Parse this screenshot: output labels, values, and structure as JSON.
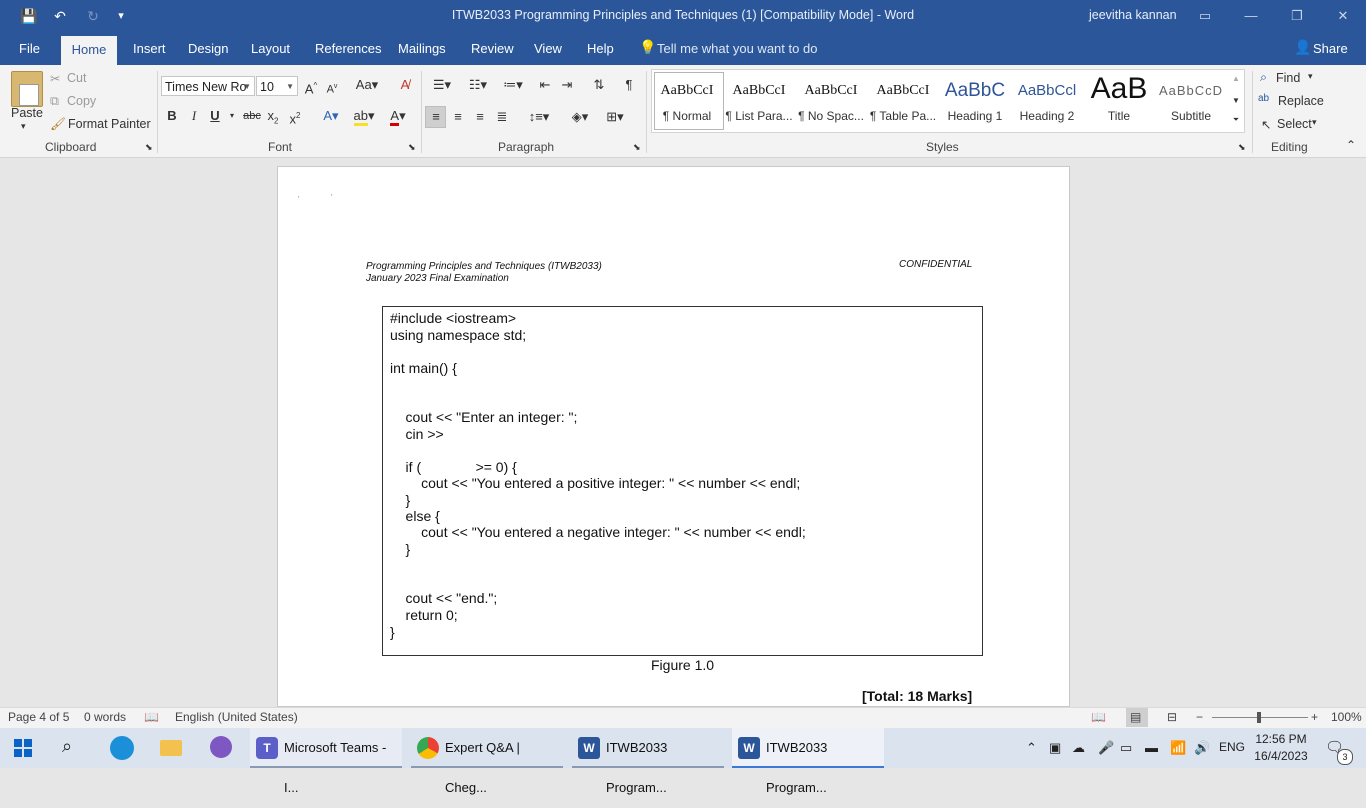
{
  "window": {
    "title": "ITWB2033 Programming Principles and Techniques (1) [Compatibility Mode]  -  Word",
    "user": "jeevitha kannan"
  },
  "quick_access": {
    "save": "💾",
    "undo": "↶",
    "redo": "↻",
    "customize": "▾"
  },
  "tabs": [
    "File",
    "Home",
    "Insert",
    "Design",
    "Layout",
    "References",
    "Mailings",
    "Review",
    "View",
    "Help"
  ],
  "tell_me": "Tell me what you want to do",
  "share": "Share",
  "ribbon": {
    "clipboard": {
      "paste": "Paste",
      "cut": "Cut",
      "copy": "Copy",
      "format_painter": "Format Painter",
      "label": "Clipboard"
    },
    "font": {
      "name": "Times New Ro",
      "size": "10",
      "label": "Font"
    },
    "paragraph": {
      "label": "Paragraph"
    },
    "styles": {
      "label": "Styles",
      "items": [
        {
          "preview": "AaBbCcI",
          "name": "¶ Normal"
        },
        {
          "preview": "AaBbCcI",
          "name": "¶ List Para..."
        },
        {
          "preview": "AaBbCcI",
          "name": "¶ No Spac..."
        },
        {
          "preview": "AaBbCcI",
          "name": "¶ Table Pa..."
        },
        {
          "preview": "AaBbC",
          "name": "Heading 1"
        },
        {
          "preview": "AaBbCcl",
          "name": "Heading 2"
        },
        {
          "preview": "AaB",
          "name": "Title"
        },
        {
          "preview": "AaBbCcD",
          "name": "Subtitle"
        }
      ]
    },
    "editing": {
      "find": "Find",
      "replace": "Replace",
      "select": "Select",
      "label": "Editing"
    }
  },
  "document": {
    "header_left_1": "Programming Principles and Techniques (ITWB2033)",
    "header_left_2": "January 2023 Final Examination",
    "header_right": "CONFIDENTIAL",
    "code_lines": [
      "#include <iostream>",
      "using namespace std;",
      "int main() {",
      "    cout << \"Enter an integer: \";",
      "    cin >>",
      "    if (              >= 0) {",
      "        cout << \"You entered a positive integer: \" << number << endl;",
      "    }",
      "    else {",
      "        cout << \"You entered a negative integer: \" << number << endl;",
      "    }",
      "    cout << \"end.\";",
      "    return 0;",
      "}"
    ],
    "figure_caption": "Figure 1.0",
    "total_marks": "[Total: 18 Marks]"
  },
  "status": {
    "page": "Page 4 of 5",
    "words": "0 words",
    "language": "English (United States)",
    "zoom": "100%"
  },
  "taskbar": {
    "apps": [
      {
        "label": "Microsoft Teams - I..."
      },
      {
        "label": "Expert Q&A | Cheg..."
      },
      {
        "label": "ITWB2033 Program..."
      },
      {
        "label": "ITWB2033 Program..."
      }
    ],
    "lang": "ENG",
    "time": "12:56 PM",
    "date": "16/4/2023",
    "notifications": "3"
  }
}
